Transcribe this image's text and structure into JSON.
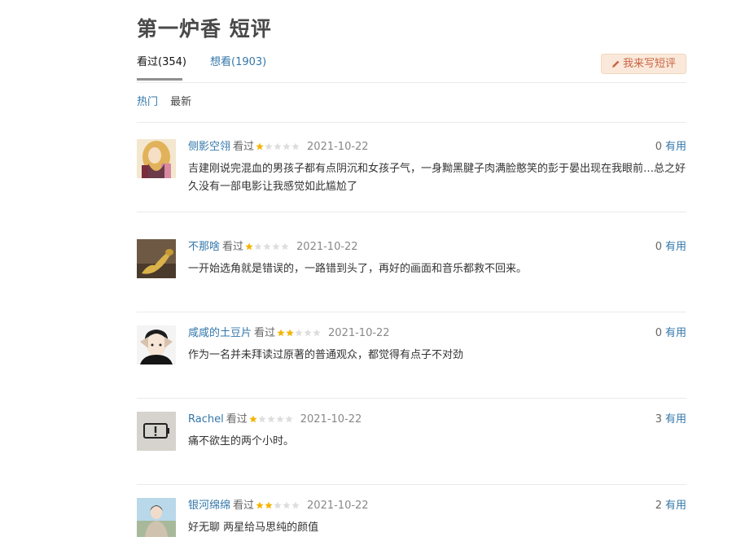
{
  "page": {
    "title": "第一炉香 短评"
  },
  "tabs": [
    {
      "label": "看过(354)"
    },
    {
      "label": "想看(1903)"
    }
  ],
  "write_button": {
    "label": "我来写短评",
    "icon": "pencil-icon",
    "color": "#ca6445",
    "bg": "#fae9da"
  },
  "sort": {
    "hot": "热门",
    "new": "最新"
  },
  "vote_label": "有用",
  "reviews": [
    {
      "author": "侧影空翎",
      "status": "看过",
      "stars": 1,
      "date": "2021-10-22",
      "votes": "0",
      "content": "吉建刚说完混血的男孩子都有点阴沉和女孩子气，一身黝黑腱子肉满脸憨笑的彭于晏出现在我眼前…总之好久没有一部电影让我感觉如此尴尬了"
    },
    {
      "author": "不那啥",
      "status": "看过",
      "stars": 1,
      "date": "2021-10-22",
      "votes": "0",
      "content": "一开始选角就是错误的，一路错到头了，再好的画面和音乐都救不回来。"
    },
    {
      "author": "咸咸的土豆片",
      "status": "看过",
      "stars": 2,
      "date": "2021-10-22",
      "votes": "0",
      "content": "作为一名并未拜读过原著的普通观众，都觉得有点子不对劲"
    },
    {
      "author": "Rachel",
      "status": "看过",
      "stars": 1,
      "date": "2021-10-22",
      "votes": "3",
      "content": "痛不欲生的两个小时。"
    },
    {
      "author": "银河绵绵",
      "status": "看过",
      "stars": 2,
      "date": "2021-10-22",
      "votes": "2",
      "content": "好无聊 两星给马思纯的颜值"
    }
  ],
  "colors": {
    "link": "#37a",
    "star_on": "#f4b400",
    "star_off": "#dddddd",
    "divider": "#eaeaea"
  }
}
